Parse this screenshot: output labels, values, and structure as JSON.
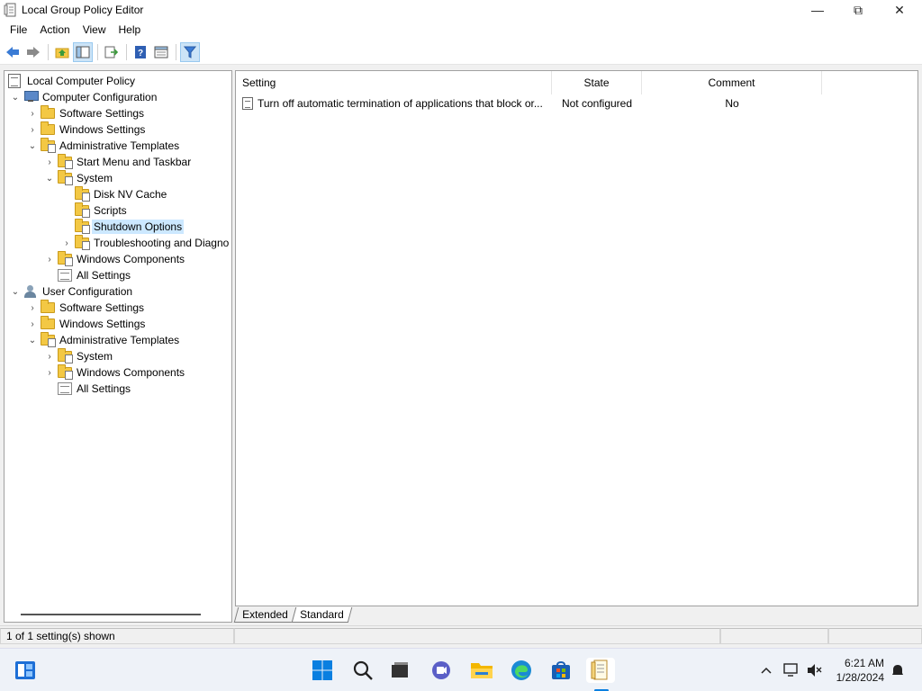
{
  "window": {
    "title": "Local Group Policy Editor",
    "controls": {
      "minimize": "—",
      "maximize": "⧉",
      "close": "✕"
    }
  },
  "menu": {
    "file": "File",
    "action": "Action",
    "view": "View",
    "help": "Help"
  },
  "toolbar": {
    "icons": [
      "back-arrow-icon",
      "forward-arrow-icon",
      "up-folder-icon",
      "show-hide-tree-icon",
      "export-list-icon",
      "help-icon",
      "properties-view-icon",
      "filter-icon"
    ]
  },
  "tree": {
    "root": "Local Computer Policy",
    "computer_config": "Computer Configuration",
    "cc_software": "Software Settings",
    "cc_windows": "Windows Settings",
    "cc_admin": "Administrative Templates",
    "cc_admin_startmenu": "Start Menu and Taskbar",
    "cc_admin_system": "System",
    "cc_sys_disknv": "Disk NV Cache",
    "cc_sys_scripts": "Scripts",
    "cc_sys_shutdown": "Shutdown Options",
    "cc_sys_troubleshoot": "Troubleshooting and Diagno",
    "cc_admin_wincomp": "Windows Components",
    "cc_admin_allsettings": "All Settings",
    "user_config": "User Configuration",
    "uc_software": "Software Settings",
    "uc_windows": "Windows Settings",
    "uc_admin": "Administrative Templates",
    "uc_admin_system": "System",
    "uc_admin_wincomp": "Windows Components",
    "uc_admin_allsettings": "All Settings"
  },
  "list": {
    "columns": {
      "setting": "Setting",
      "state": "State",
      "comment": "Comment"
    },
    "rows": [
      {
        "setting": "Turn off automatic termination of applications that block or...",
        "state": "Not configured",
        "comment": "No"
      }
    ]
  },
  "tabs": {
    "extended": "Extended",
    "standard": "Standard"
  },
  "status": {
    "text": "1 of 1 setting(s) shown"
  },
  "taskbar": {
    "time": "6:21 AM",
    "date": "1/28/2024",
    "icons": [
      "widgets-icon",
      "start-icon",
      "search-icon",
      "task-view-icon",
      "chat-icon",
      "file-explorer-icon",
      "edge-icon",
      "store-icon",
      "group-policy-editor-icon",
      "chevron-up-icon",
      "network-icon",
      "volume-muted-icon",
      "notification-icon"
    ]
  }
}
